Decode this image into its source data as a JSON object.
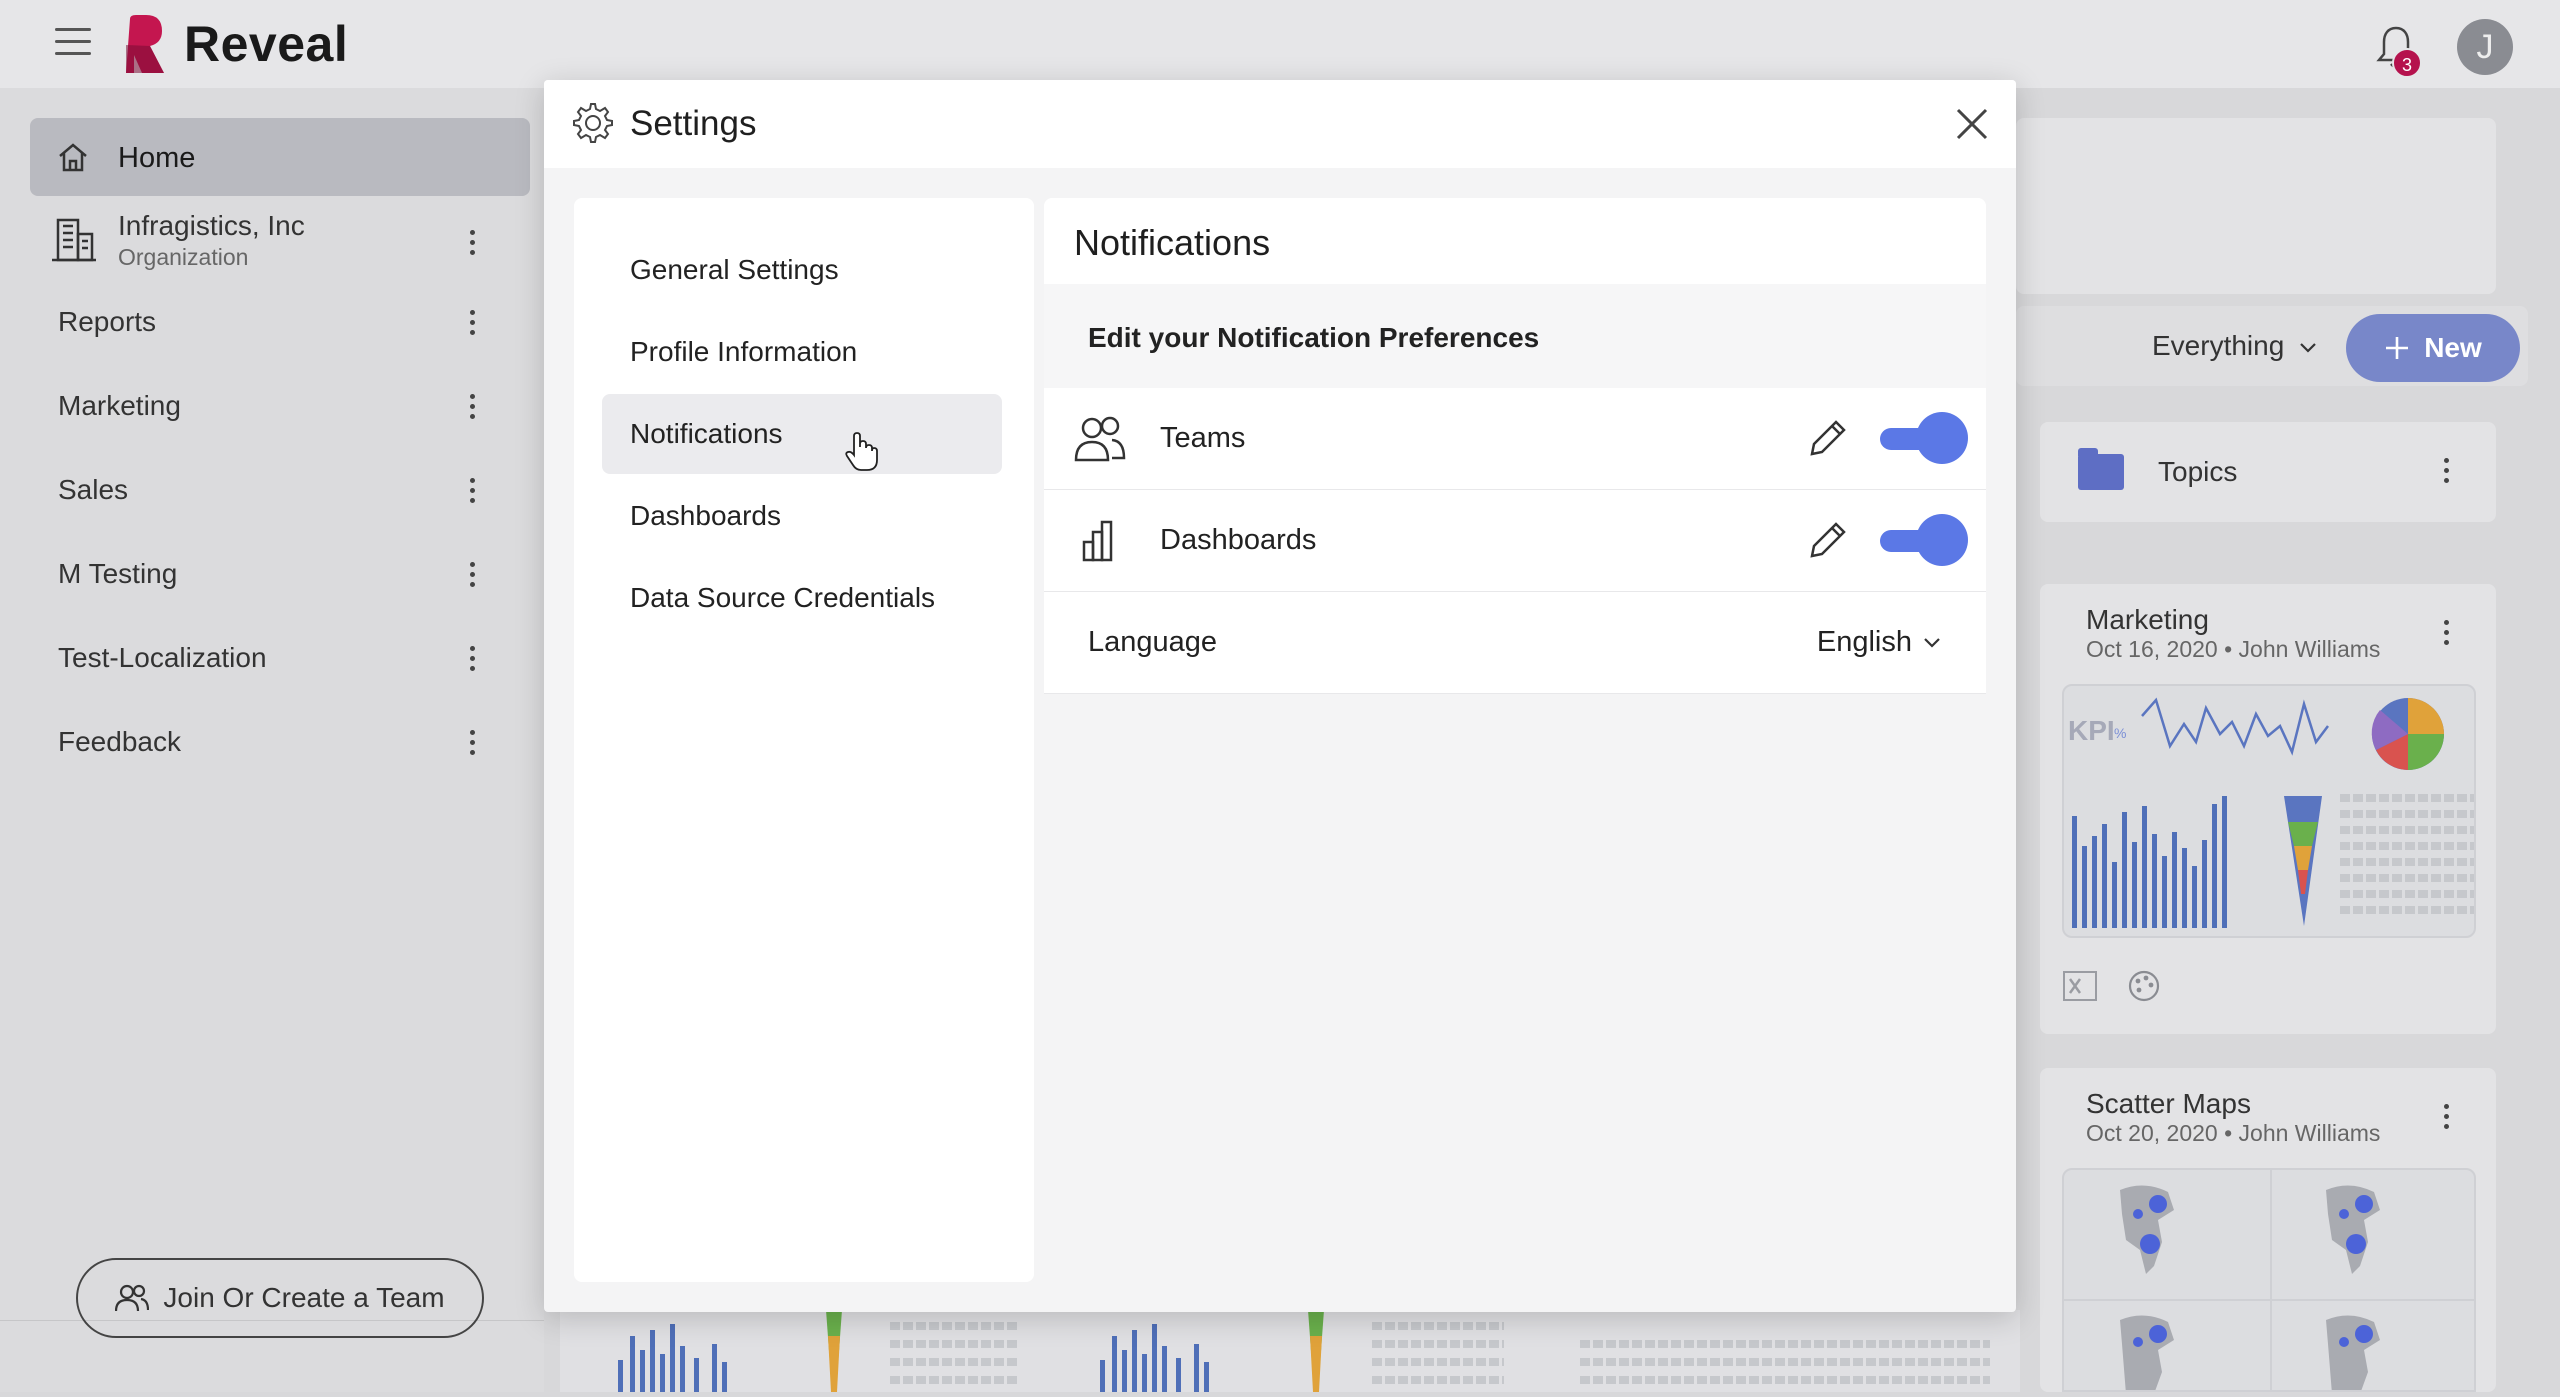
{
  "app": {
    "brand": "Reveal",
    "notification_count": "3",
    "avatar_initial": "J"
  },
  "sidebar": {
    "home_label": "Home",
    "org_name": "Infragistics, Inc",
    "org_sub": "Organization",
    "items": [
      {
        "label": "Reports"
      },
      {
        "label": "Marketing"
      },
      {
        "label": "Sales"
      },
      {
        "label": "M Testing"
      },
      {
        "label": "Test-Localization"
      },
      {
        "label": "Feedback"
      }
    ],
    "team_button": "Join Or Create a Team"
  },
  "main": {
    "filter_label": "Everything",
    "new_button": "New",
    "topics_label": "Topics",
    "dashboards": [
      {
        "title": "Marketing",
        "subtitle": "Oct 16, 2020 • John Williams"
      },
      {
        "title": "Scatter Maps",
        "subtitle": "Oct 20, 2020 • John Williams"
      }
    ],
    "kpi_text": "KPI",
    "kpi_pct": "%"
  },
  "settings": {
    "title": "Settings",
    "nav": [
      {
        "label": "General Settings"
      },
      {
        "label": "Profile Information"
      },
      {
        "label": "Notifications"
      },
      {
        "label": "Dashboards"
      },
      {
        "label": "Data Source Credentials"
      }
    ],
    "active_nav": "Notifications",
    "content_title": "Notifications",
    "pref_title": "Edit your Notification Preferences",
    "rows": [
      {
        "label": "Teams",
        "icon": "users-icon",
        "enabled": true
      },
      {
        "label": "Dashboards",
        "icon": "bar-chart-icon",
        "enabled": true
      }
    ],
    "language_label": "Language",
    "language_value": "English"
  },
  "colors": {
    "accent": "#5b78e6",
    "badge": "#b5124d",
    "brand": "#c4164f"
  }
}
